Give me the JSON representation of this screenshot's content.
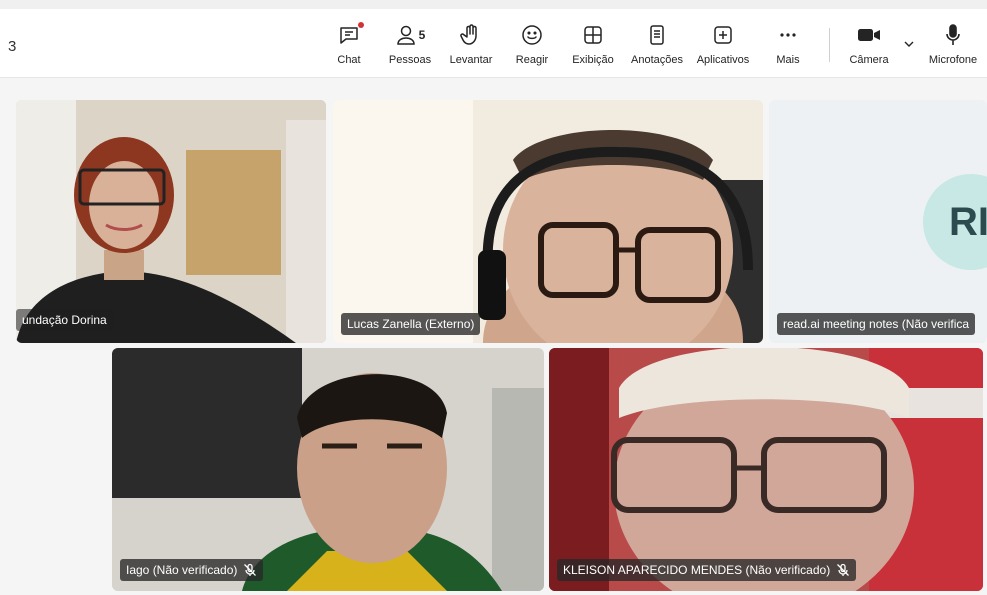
{
  "timer": "3",
  "toolbar": [
    {
      "id": "chat",
      "label": "Chat",
      "icon": "chat-icon"
    },
    {
      "id": "people",
      "label": "Pessoas",
      "icon": "people-icon",
      "count": "5"
    },
    {
      "id": "raise",
      "label": "Levantar",
      "icon": "raise-hand-icon"
    },
    {
      "id": "react",
      "label": "Reagir",
      "icon": "smiley-icon"
    },
    {
      "id": "view",
      "label": "Exibição",
      "icon": "grid-view-icon"
    },
    {
      "id": "notes",
      "label": "Anotações",
      "icon": "notes-icon"
    },
    {
      "id": "apps",
      "label": "Aplicativos",
      "icon": "add-app-icon"
    },
    {
      "id": "more",
      "label": "Mais",
      "icon": "more-dots-icon"
    },
    {
      "id": "camera",
      "label": "Câmera",
      "icon": "camera-icon"
    },
    {
      "id": "mic",
      "label": "Microfone",
      "icon": "microphone-icon"
    }
  ],
  "participants": [
    {
      "name": "undação Dorina"
    },
    {
      "name": "Lucas Zanella (Externo)"
    },
    {
      "name": "read.ai meeting notes (Não verifica",
      "initials": "RI"
    },
    {
      "name": "Iago (Não verificado)",
      "muted": true
    },
    {
      "name": "KLEISON APARECIDO MENDES (Não verificado)",
      "muted": true
    }
  ],
  "colors": {
    "notification": "#d13438",
    "avatar_bg": "#c7e8e5",
    "tile_label_bg": "#282828"
  }
}
